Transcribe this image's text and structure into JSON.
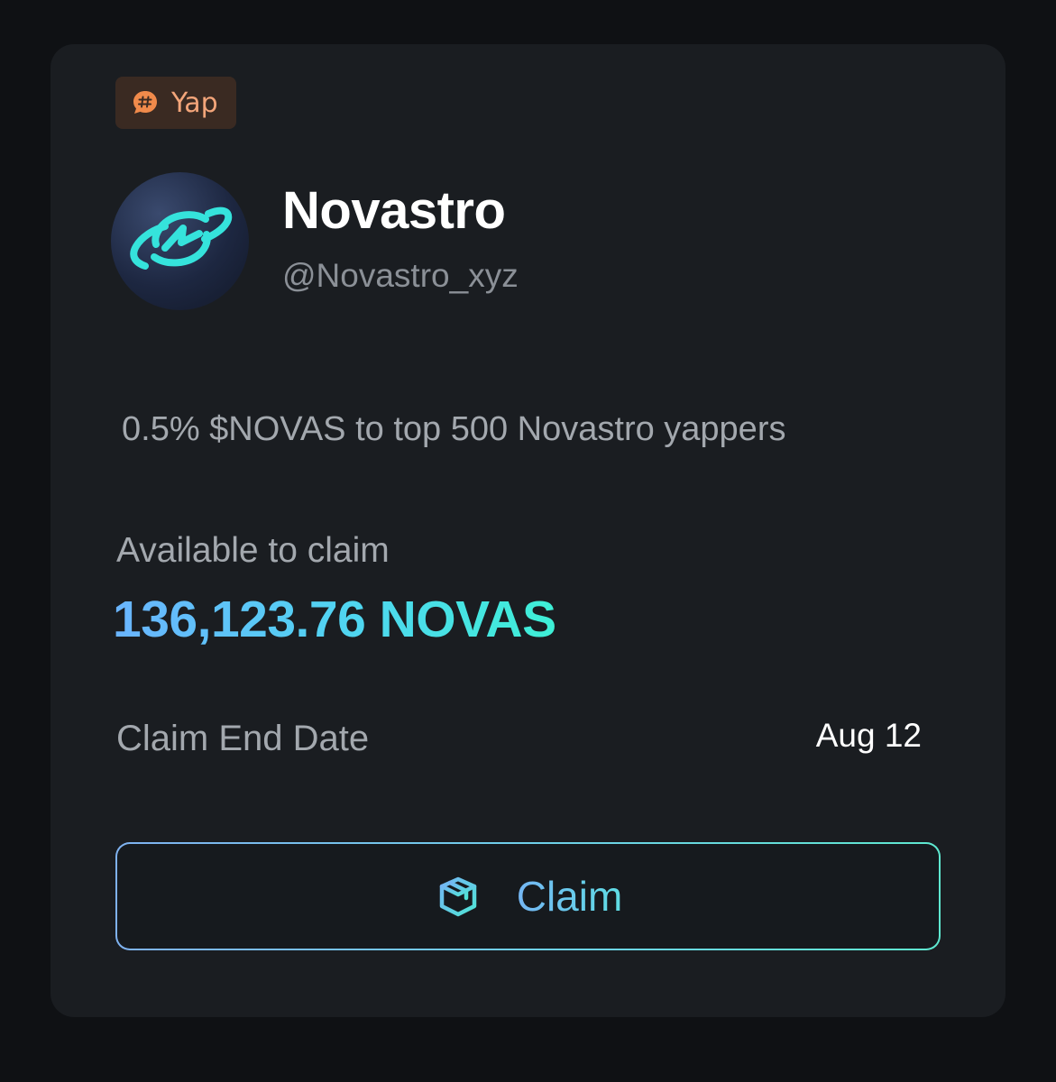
{
  "tag": {
    "label": "Yap",
    "icon": "hashtag-chat-icon",
    "color": "#f3a57a"
  },
  "project": {
    "name": "Novastro",
    "handle": "@Novastro_xyz",
    "avatar_icon": "planet-lightning-logo"
  },
  "description": "0.5% $NOVAS to top 500 Novastro yappers",
  "claim": {
    "available_label": "Available to claim",
    "amount": "136,123.76 NOVAS",
    "end_label": "Claim End Date",
    "end_value": "Aug 12",
    "button_label": "Claim",
    "button_icon": "box-icon"
  },
  "colors": {
    "accent_start": "#6ab4ff",
    "accent_end": "#3ef0d6",
    "card_background": "#1a1d21",
    "page_background": "#0f1114"
  }
}
